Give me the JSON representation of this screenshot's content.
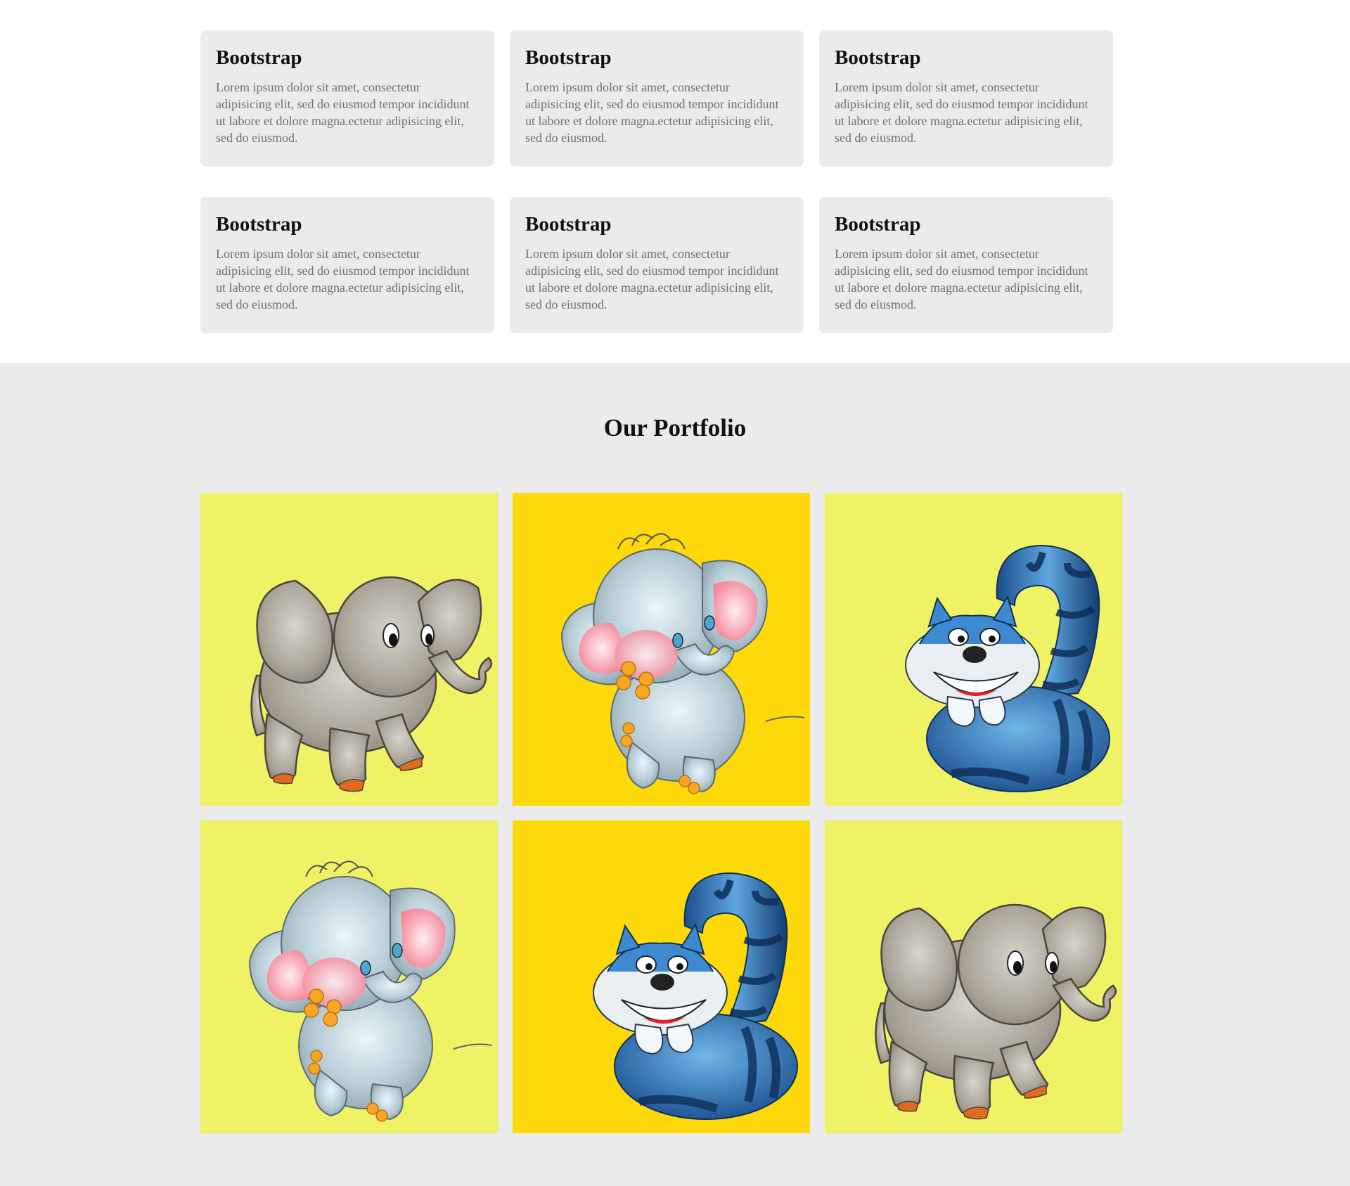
{
  "features": {
    "cards": [
      {
        "title": "Bootstrap",
        "text": "Lorem ipsum dolor sit amet, consectetur adipisicing elit, sed do eiusmod tempor incididunt ut labore et dolore magna.ectetur adipisicing elit, sed do eiusmod."
      },
      {
        "title": "Bootstrap",
        "text": "Lorem ipsum dolor sit amet, consectetur adipisicing elit, sed do eiusmod tempor incididunt ut labore et dolore magna.ectetur adipisicing elit, sed do eiusmod."
      },
      {
        "title": "Bootstrap",
        "text": "Lorem ipsum dolor sit amet, consectetur adipisicing elit, sed do eiusmod tempor incididunt ut labore et dolore magna.ectetur adipisicing elit, sed do eiusmod."
      },
      {
        "title": "Bootstrap",
        "text": "Lorem ipsum dolor sit amet, consectetur adipisicing elit, sed do eiusmod tempor incididunt ut labore et dolore magna.ectetur adipisicing elit, sed do eiusmod."
      },
      {
        "title": "Bootstrap",
        "text": "Lorem ipsum dolor sit amet, consectetur adipisicing elit, sed do eiusmod tempor incididunt ut labore et dolore magna.ectetur adipisicing elit, sed do eiusmod."
      },
      {
        "title": "Bootstrap",
        "text": "Lorem ipsum dolor sit amet, consectetur adipisicing elit, sed do eiusmod tempor incididunt ut labore et dolore magna.ectetur adipisicing elit, sed do eiusmod."
      }
    ]
  },
  "portfolio": {
    "title": "Our Portfolio",
    "items": [
      {
        "subject": "grey-elephant",
        "background": "#f0f266"
      },
      {
        "subject": "blue-baby-elephant",
        "background": "#fdd80b"
      },
      {
        "subject": "cheshire-cat",
        "background": "#f0f266"
      },
      {
        "subject": "blue-baby-elephant",
        "background": "#f0f266"
      },
      {
        "subject": "cheshire-cat",
        "background": "#fdd80b"
      },
      {
        "subject": "grey-elephant",
        "background": "#f0f266"
      }
    ]
  },
  "colors": {
    "card_bg": "#ebebeb",
    "section_bg": "#ebebeb",
    "tile_light_yellow": "#f0f266",
    "tile_gold_yellow": "#fdd80b"
  }
}
